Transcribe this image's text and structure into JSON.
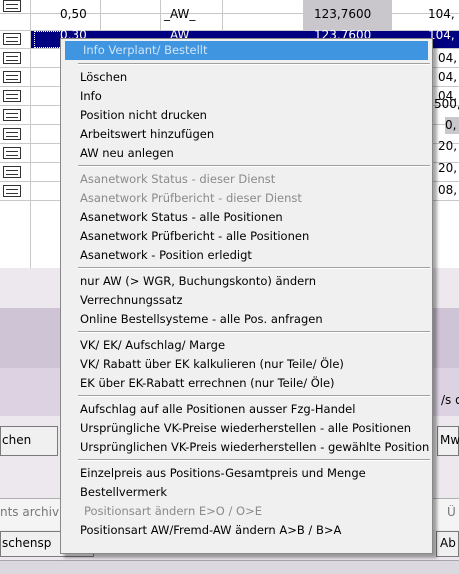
{
  "grid": {
    "row0": {
      "qty": "0,50",
      "type": "_AW_",
      "value": "123,7600",
      "right": "104,"
    },
    "row1": {
      "qty": "0,30",
      "type": "_AW_",
      "value": "123,7600",
      "right": "104,"
    },
    "right_column": [
      "04,",
      "04,",
      "04,",
      "500,",
      "0,",
      "20,",
      "20,",
      "08,"
    ]
  },
  "lower": {
    "button_left": "chen",
    "button_right": "Mw",
    "label_right": "/s o",
    "archive_field": "nts archiv",
    "archive_right": "Ü",
    "tab_left": "schensp",
    "tab_right": "Ab"
  },
  "context_menu": {
    "header": "Info Verplant/ Bestellt",
    "groups": [
      [
        {
          "label": "Löschen",
          "enabled": true
        },
        {
          "label": "Info",
          "enabled": true
        },
        {
          "label": "Position nicht drucken",
          "enabled": true
        },
        {
          "label": "Arbeitswert hinzufügen",
          "enabled": true
        },
        {
          "label": "AW neu anlegen",
          "enabled": true
        }
      ],
      [
        {
          "label": "Asanetwork Status - dieser Dienst",
          "enabled": false
        },
        {
          "label": "Asanetwork Prüfbericht - dieser Dienst",
          "enabled": false
        },
        {
          "label": "Asanetwork Status - alle Positionen",
          "enabled": true
        },
        {
          "label": "Asanetwork Prüfbericht - alle Positionen",
          "enabled": true
        },
        {
          "label": "Asanetwork - Position erledigt",
          "enabled": true
        }
      ],
      [
        {
          "label": "nur AW (> WGR, Buchungskonto) ändern",
          "enabled": true
        },
        {
          "label": "Verrechnungssatz",
          "enabled": true
        },
        {
          "label": "Online Bestellsysteme - alle Pos. anfragen",
          "enabled": true
        }
      ],
      [
        {
          "label": "VK/ EK/ Aufschlag/ Marge",
          "enabled": true
        },
        {
          "label": "VK/ Rabatt über EK kalkulieren (nur Teile/ Öle)",
          "enabled": true
        },
        {
          "label": "EK über EK-Rabatt errechnen (nur Teile/ Öle)",
          "enabled": true
        }
      ],
      [
        {
          "label": "Aufschlag auf alle Positionen ausser Fzg-Handel",
          "enabled": true
        },
        {
          "label": "Ursprüngliche VK-Preise wiederherstellen - alle Positionen",
          "enabled": true
        },
        {
          "label": "Ursprünglichen VK-Preis wiederherstellen - gewählte Position",
          "enabled": true
        }
      ],
      [
        {
          "label": "Einzelpreis aus Positions-Gesamtpreis und Menge",
          "enabled": true
        },
        {
          "label": "Bestellvermerk",
          "enabled": true
        },
        {
          "label": "Positionsart ändern E>O / O>E",
          "enabled": false
        },
        {
          "label": "Positionsart AW/Fremd-AW ändern A>B / B>A",
          "enabled": true
        }
      ]
    ]
  }
}
